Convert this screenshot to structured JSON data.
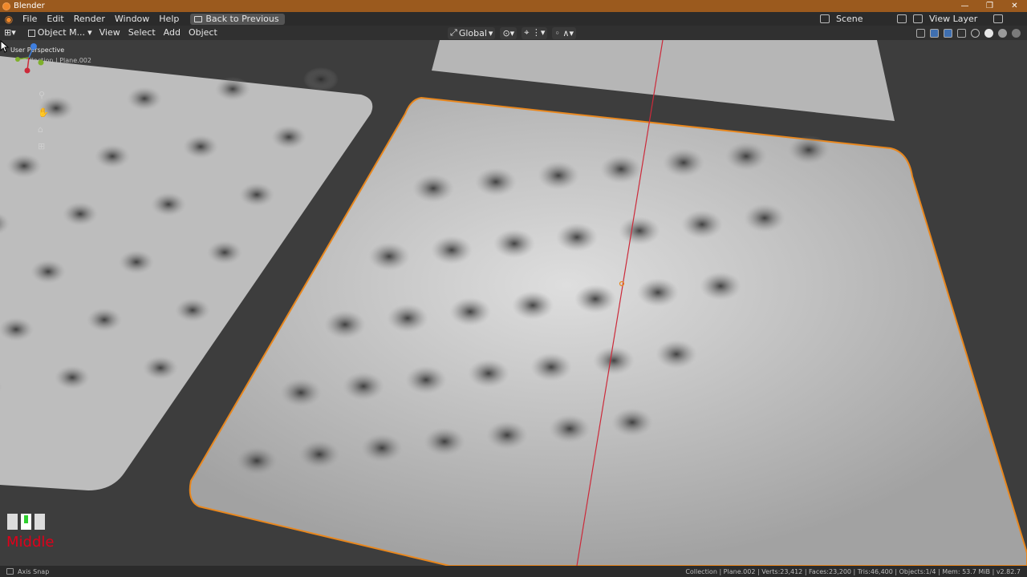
{
  "window": {
    "title": "Blender",
    "controls": [
      "—",
      "❐",
      "✕"
    ]
  },
  "menu": {
    "items": [
      "File",
      "Edit",
      "Render",
      "Window",
      "Help"
    ],
    "back_button": "Back to Previous",
    "scene_label": "Scene",
    "view_layer_label": "View Layer"
  },
  "toolbar": {
    "mode": "Object M...",
    "items": [
      "View",
      "Select",
      "Add",
      "Object"
    ],
    "orientation": "Global"
  },
  "viewport": {
    "perspective": "User Perspective",
    "collection": "(1) Collection | Plane.002"
  },
  "overlay": {
    "mouse_label": "Middle"
  },
  "status": {
    "left": "Axis Snap",
    "right": "Collection | Plane.002 | Verts:23,412 | Faces:23,200 | Tris:46,400 | Objects:1/4 | Mem: 53.7 MiB | v2.82.7"
  },
  "colors": {
    "selection": "#e8871e",
    "x_axis": "#cc2a3a",
    "y_axis": "#7fb02b",
    "z_axis": "#3f7fe0",
    "title_bar": "#9b5a1e"
  }
}
